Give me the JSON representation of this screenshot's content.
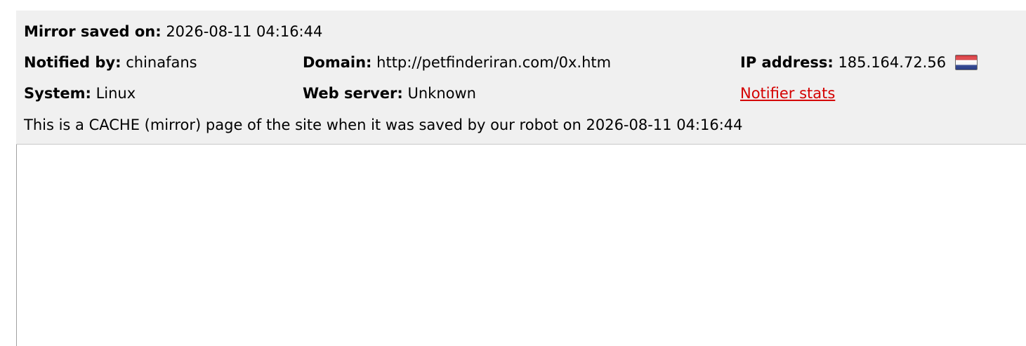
{
  "mirror": {
    "saved_label": "Mirror saved on:",
    "saved_value": "2026-08-11 04:16:44"
  },
  "notifier": {
    "label": "Notified by:",
    "value": "chinafans"
  },
  "domain": {
    "label": "Domain:",
    "value": "http://petfinderiran.com/0x.htm"
  },
  "ip": {
    "label": "IP address:",
    "value": "185.164.72.56",
    "flag_icon": "netherlands-flag-icon"
  },
  "system": {
    "label": "System:",
    "value": "Linux"
  },
  "webserver": {
    "label": "Web server:",
    "value": "Unknown"
  },
  "links": {
    "notifier_stats": "Notifier stats"
  },
  "notice": "This is a CACHE (mirror) page of the site when it was saved by our robot on 2026-08-11 04:16:44",
  "colors": {
    "panel_background": "#f0f0f0",
    "link": "#d40000"
  }
}
